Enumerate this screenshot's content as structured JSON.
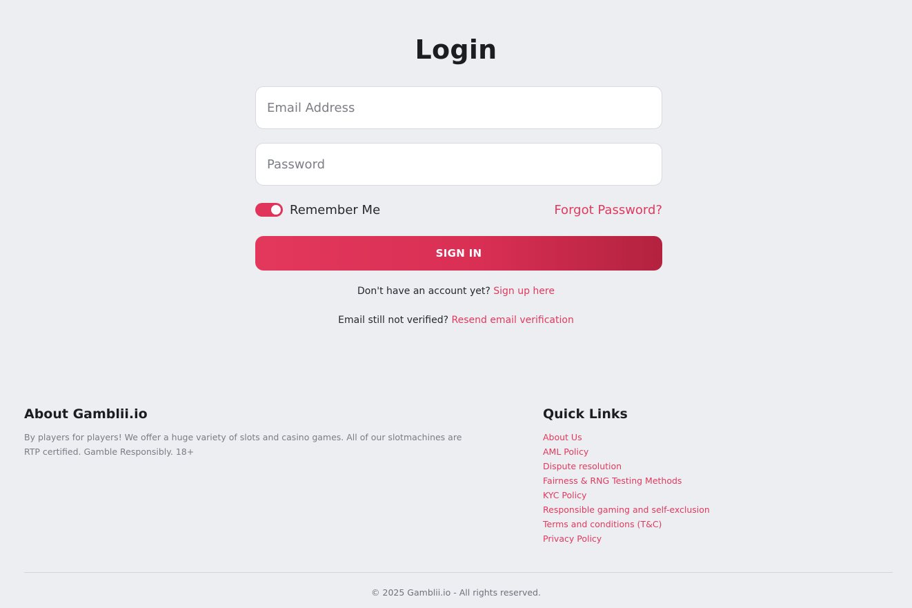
{
  "login": {
    "title": "Login",
    "email_placeholder": "Email Address",
    "email_value": "",
    "password_placeholder": "Password",
    "password_value": "",
    "remember_label": "Remember Me",
    "remember_checked": true,
    "forgot_label": "Forgot Password?",
    "signin_label": "SIGN IN",
    "signup_prompt": "Don't have an account yet?",
    "signup_link": "Sign up here",
    "verify_prompt": "Email still not verified?",
    "verify_link": "Resend email verification"
  },
  "footer": {
    "about_title": "About Gamblii.io",
    "about_text": "By players for players! We offer a huge variety of slots and casino games. All of our slotmachines are RTP certified. Gamble Responsibly. 18+",
    "quick_links_title": "Quick Links",
    "quick_links": [
      "About Us",
      "AML Policy",
      "Dispute resolution",
      "Fairness & RNG Testing Methods",
      "KYC Policy",
      "Responsible gaming and self-exclusion",
      "Terms and conditions (T&C)",
      "Privacy Policy"
    ],
    "copyright": "© 2025 Gamblii.io - All rights reserved."
  },
  "colors": {
    "accent": "#e0345a",
    "background": "#edeef2",
    "heading": "#1c1d21"
  }
}
